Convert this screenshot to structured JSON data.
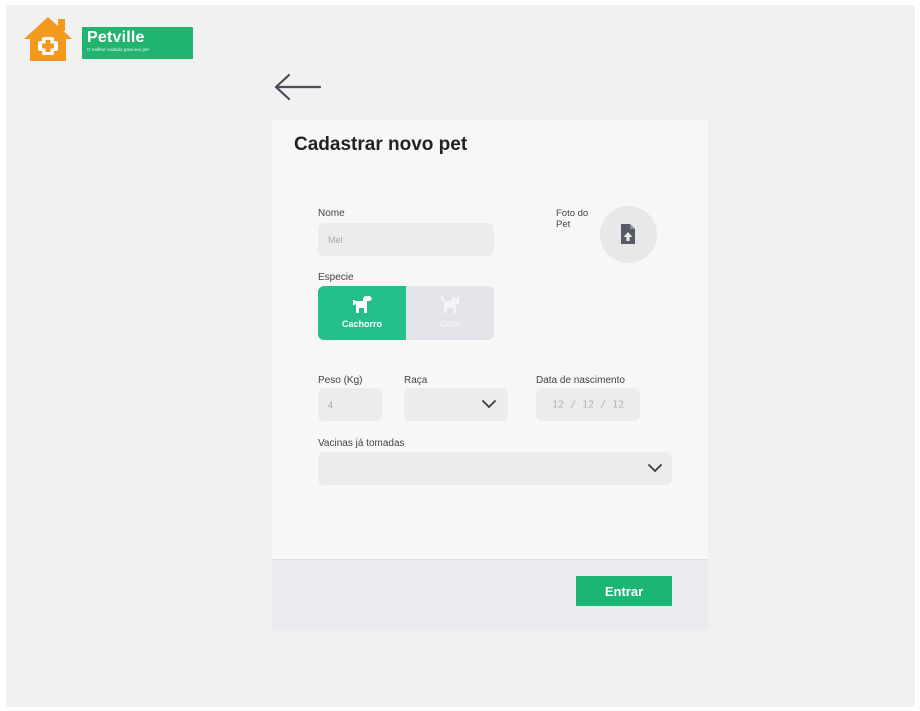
{
  "brand": {
    "name": "Petville",
    "tagline": "O melhor cuidado para seu pet",
    "colors": {
      "primary": "#21b46f",
      "house": "#f39a1e"
    }
  },
  "form": {
    "title": "Cadastrar novo pet",
    "name": {
      "label": "Nome",
      "value": "Mel"
    },
    "photo": {
      "label": "Foto do Pet",
      "icon": "file-upload-icon"
    },
    "species": {
      "label": "Especie",
      "options": [
        {
          "label": "Cachorro",
          "icon": "dog-icon",
          "selected": true
        },
        {
          "label": "Gato",
          "icon": "cat-icon",
          "selected": false
        }
      ]
    },
    "weight": {
      "label": "Peso (Kg)",
      "value": "4"
    },
    "breed": {
      "label": "Raça",
      "value": ""
    },
    "birth": {
      "label": "Data de nascimento",
      "day": "12",
      "month": "12",
      "year": "12"
    },
    "vaccines": {
      "label": "Vacinas já tomadas",
      "value": ""
    },
    "submit_label": "Entrar"
  }
}
